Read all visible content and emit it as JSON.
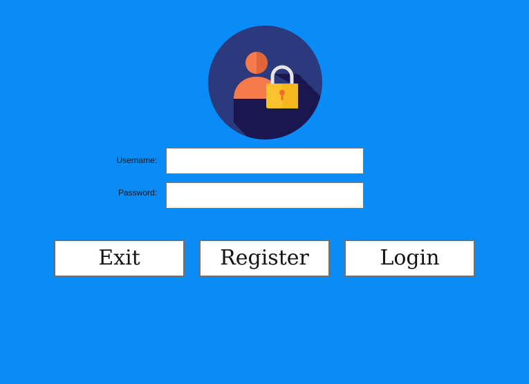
{
  "logo": {
    "icon": "user-lock-icon",
    "colors": {
      "circle": "#2b3a7c",
      "shadow": "#1a1650",
      "person": "#f47b4c",
      "lock_body": "#f9c22e",
      "lock_shackle": "#e6e6e6",
      "keyhole": "#f26b2a"
    }
  },
  "form": {
    "username_label": "Username:",
    "username_value": "",
    "password_label": "Password:",
    "password_value": ""
  },
  "buttons": {
    "exit_label": "Exit",
    "register_label": "Register",
    "login_label": "Login"
  },
  "colors": {
    "background": "#0a8cf7",
    "button_border": "#6f6f6f",
    "input_border": "#7a7a7a"
  }
}
